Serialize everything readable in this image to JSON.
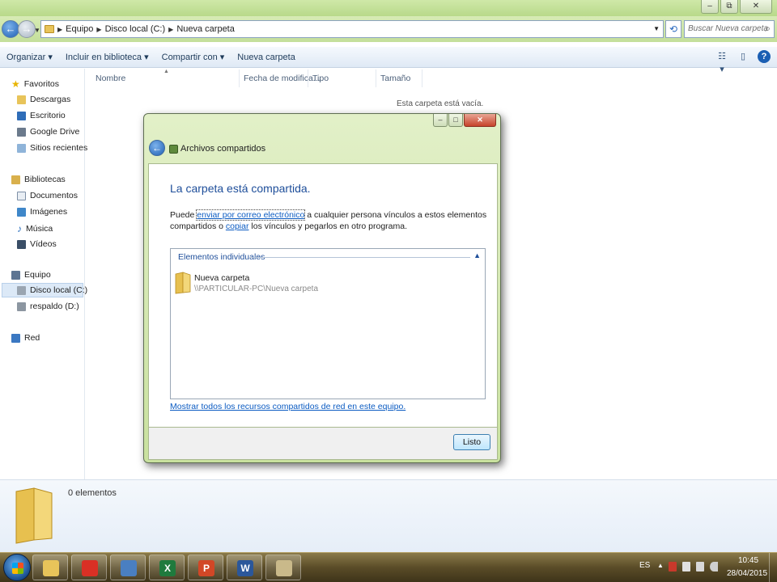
{
  "window": {
    "controls": {
      "minimize": "‒",
      "maximize": "⧉",
      "close": "✕"
    }
  },
  "address": {
    "breadcrumbs": [
      "Equipo",
      "Disco local (C:)",
      "Nueva carpeta"
    ],
    "search_placeholder": "Buscar Nueva carpeta"
  },
  "toolbar": {
    "organize": "Organizar ▾",
    "include_library": "Incluir en biblioteca ▾",
    "share_with": "Compartir con ▾",
    "new_folder": "Nueva carpeta"
  },
  "sidebar": {
    "favorites": {
      "label": "Favoritos",
      "items": [
        "Descargas",
        "Escritorio",
        "Google Drive",
        "Sitios recientes"
      ]
    },
    "libraries": {
      "label": "Bibliotecas",
      "items": [
        "Documentos",
        "Imágenes",
        "Música",
        "Vídeos"
      ]
    },
    "computer": {
      "label": "Equipo",
      "items": [
        "Disco local (C:)",
        "respaldo (D:)"
      ]
    },
    "network": {
      "label": "Red"
    }
  },
  "columns": [
    "Nombre",
    "Fecha de modifica...",
    "Tipo",
    "Tamaño"
  ],
  "empty_message": "Esta carpeta está vacía.",
  "details": {
    "count": "0 elementos"
  },
  "dialog": {
    "title": "Archivos compartidos",
    "heading": "La carpeta está compartida.",
    "text_prefix": "Puede ",
    "link_email": "enviar por correo electrónico",
    "text_middle": " a cualquier persona vínculos a estos elementos compartidos o ",
    "link_copy": "copiar",
    "text_suffix": " los vínculos y pegarlos en otro programa.",
    "items_header": "Elementos individuales",
    "item_name": "Nueva carpeta",
    "item_path": "\\\\PARTICULAR-PC\\Nueva carpeta",
    "show_all": "Mostrar todos los recursos compartidos de red en este equipo.",
    "ok": "Listo"
  },
  "taskbar": {
    "apps": [
      {
        "name": "explorer",
        "glyph": "",
        "color": "#e8c45a"
      },
      {
        "name": "chrome",
        "glyph": "",
        "color": "#d93025"
      },
      {
        "name": "scanner",
        "glyph": "",
        "color": "#4a7fc1"
      },
      {
        "name": "excel",
        "glyph": "X",
        "color": "#1f7a3d"
      },
      {
        "name": "powerpoint",
        "glyph": "P",
        "color": "#d24726"
      },
      {
        "name": "word",
        "glyph": "W",
        "color": "#2b579a"
      },
      {
        "name": "paint",
        "glyph": "",
        "color": "#c9b98a"
      }
    ],
    "lang": "ES",
    "time": "10:45",
    "date": "28/04/2015"
  }
}
